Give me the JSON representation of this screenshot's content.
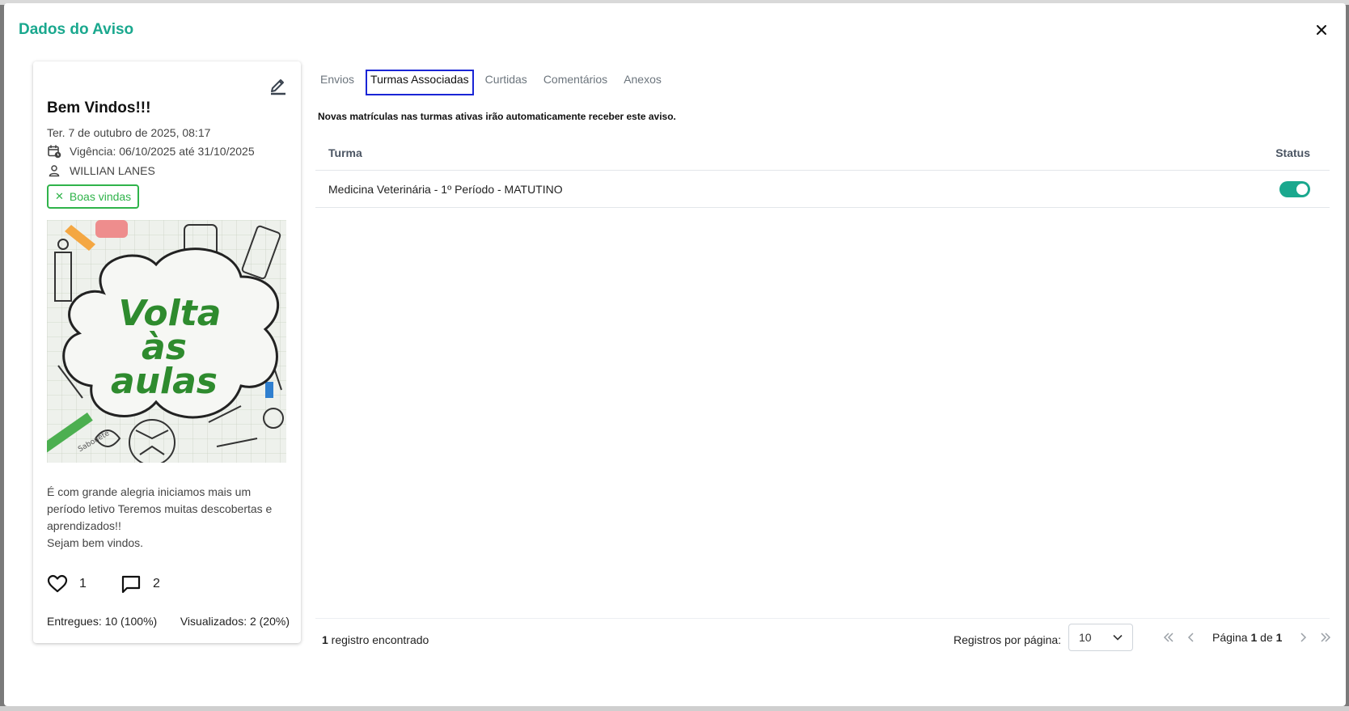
{
  "modal": {
    "title": "Dados do Aviso"
  },
  "card": {
    "title": "Bem Vindos!!!",
    "date": "Ter. 7 de outubro de 2025, 08:17",
    "validity": "Vigência: 06/10/2025 até 31/10/2025",
    "author": "WILLIAN LANES",
    "tag": "Boas vindas",
    "image_text": {
      "line1": "Volta",
      "line2": "às",
      "line3": "aulas",
      "sticker": "Sabonete"
    },
    "description": [
      "É com grande alegria iniciamos mais um período letivo Teremos muitas descobertas e aprendizados!!",
      "Sejam bem vindos."
    ],
    "likes": "1",
    "comments": "2",
    "delivered": "Entregues: 10 (100%)",
    "viewed": "Visualizados: 2 (20%)"
  },
  "tabs": [
    {
      "label": "Envios",
      "active": false
    },
    {
      "label": "Turmas Associadas",
      "active": true
    },
    {
      "label": "Curtidas",
      "active": false
    },
    {
      "label": "Comentários",
      "active": false
    },
    {
      "label": "Anexos",
      "active": false
    }
  ],
  "notice": "Novas matrículas nas turmas ativas irão automaticamente receber este aviso.",
  "table": {
    "headers": {
      "turma": "Turma",
      "status": "Status"
    },
    "rows": [
      {
        "turma": "Medicina Veterinária - 1º Período - MATUTINO",
        "status_on": true
      }
    ]
  },
  "footer": {
    "count_number": "1",
    "count_text": " registro encontrado",
    "rows_per_page_label": "Registros por página:",
    "rows_per_page_value": "10",
    "page_prefix": "Página ",
    "page_current": "1",
    "page_sep": " de ",
    "page_total": "1"
  },
  "colors": {
    "brand": "#1aa88e",
    "tag": "#2fb34a",
    "active_tab_border": "#1a25d6"
  }
}
